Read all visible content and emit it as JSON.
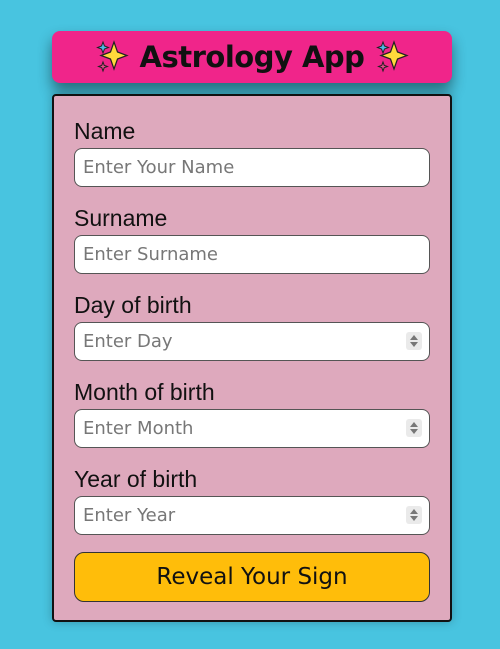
{
  "header": {
    "title": "Astrology App",
    "left_icon": "sparkles-icon",
    "right_icon": "sparkles-icon"
  },
  "form": {
    "fields": [
      {
        "label": "Name",
        "placeholder": "Enter Your Name",
        "type": "text"
      },
      {
        "label": "Surname",
        "placeholder": "Enter Surname",
        "type": "text"
      },
      {
        "label": "Day of birth",
        "placeholder": "Enter Day",
        "type": "number"
      },
      {
        "label": "Month of birth",
        "placeholder": "Enter Month",
        "type": "number"
      },
      {
        "label": "Year of birth",
        "placeholder": "Enter Year",
        "type": "number"
      }
    ],
    "submit_label": "Reveal Your Sign"
  },
  "colors": {
    "background": "#48c4e0",
    "header": "#f0258a",
    "card": "#dea9bd",
    "button": "#ffbd0a"
  }
}
